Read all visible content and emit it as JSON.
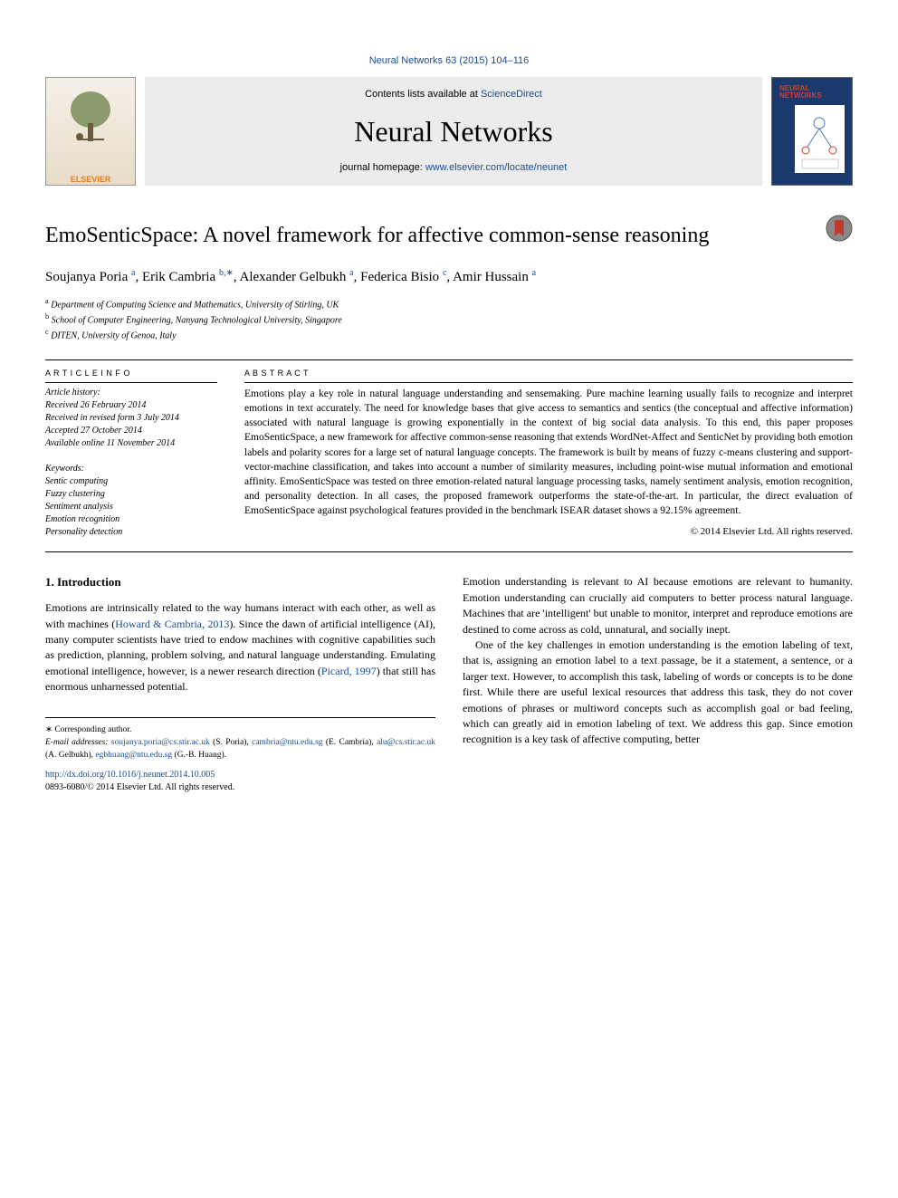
{
  "header": {
    "journal_ref": "Neural Networks 63 (2015) 104–116",
    "contents_prefix": "Contents lists available at ",
    "contents_link": "ScienceDirect",
    "journal_title": "Neural Networks",
    "homepage_prefix": "journal homepage: ",
    "homepage_link": "www.elsevier.com/locate/neunet",
    "publisher_logo": "ELSEVIER",
    "cover_text": "NEURAL NETWORKS"
  },
  "title": "EmoSenticSpace: A novel framework for affective common-sense reasoning",
  "authors": [
    {
      "name": "Soujanya Poria",
      "aff": "a"
    },
    {
      "name": "Erik Cambria",
      "aff": "b,∗"
    },
    {
      "name": "Alexander Gelbukh",
      "aff": "a"
    },
    {
      "name": "Federica Bisio",
      "aff": "c"
    },
    {
      "name": "Amir Hussain",
      "aff": "a"
    }
  ],
  "affiliations": {
    "a": "Department of Computing Science and Mathematics, University of Stirling, UK",
    "b": "School of Computer Engineering, Nanyang Technological University, Singapore",
    "c": "DITEN, University of Genoa, Italy"
  },
  "history": {
    "label": "A R T I C L E   I N F O",
    "history_label": "Article history:",
    "received": "Received 26 February 2014",
    "revised": "Received in revised form 3 July 2014",
    "accepted": "Accepted 27 October 2014",
    "online": "Available online 11 November 2014"
  },
  "keywords": {
    "label": "Keywords:",
    "items": [
      "Sentic computing",
      "Fuzzy clustering",
      "Sentiment analysis",
      "Emotion recognition",
      "Personality detection"
    ]
  },
  "abstract": {
    "label": "A B S T R A C T",
    "text": "Emotions play a key role in natural language understanding and sensemaking. Pure machine learning usually fails to recognize and interpret emotions in text accurately. The need for knowledge bases that give access to semantics and sentics (the conceptual and affective information) associated with natural language is growing exponentially in the context of big social data analysis. To this end, this paper proposes EmoSenticSpace, a new framework for affective common-sense reasoning that extends WordNet-Affect and SenticNet by providing both emotion labels and polarity scores for a large set of natural language concepts. The framework is built by means of fuzzy c-means clustering and support-vector-machine classification, and takes into account a number of similarity measures, including point-wise mutual information and emotional affinity. EmoSenticSpace was tested on three emotion-related natural language processing tasks, namely sentiment analysis, emotion recognition, and personality detection. In all cases, the proposed framework outperforms the state-of-the-art. In particular, the direct evaluation of EmoSenticSpace against psychological features provided in the benchmark ISEAR dataset shows a 92.15% agreement.",
    "copyright": "© 2014 Elsevier Ltd. All rights reserved."
  },
  "body": {
    "section_heading": "1. Introduction",
    "left_para1": "Emotions are intrinsically related to the way humans interact with each other, as well as with machines (",
    "cite_howard": "Howard & Cambria, 2013",
    "left_para1b": "). Since the dawn of artificial intelligence (AI), many computer scientists have tried to endow machines with cognitive capabilities such as prediction, planning, problem solving, and natural language understanding. Emulating emotional intelligence, however, is a newer research direction (",
    "cite_picard": "Picard, 1997",
    "left_para1c": ") that still has enormous unharnessed potential.",
    "right_para1": "Emotion understanding is relevant to AI because emotions are relevant to humanity. Emotion understanding can crucially aid computers to better process natural language. Machines that are 'intelligent' but unable to monitor, interpret and reproduce emotions are destined to come across as cold, unnatural, and socially inept.",
    "right_para2": "One of the key challenges in emotion understanding is the emotion labeling of text, that is, assigning an emotion label to a text passage, be it a statement, a sentence, or a larger text. However, to accomplish this task, labeling of words or concepts is to be done first. While there are useful lexical resources that address this task, they do not cover emotions of phrases or multiword concepts such as accomplish goal or bad feeling, which can greatly aid in emotion labeling of text. We address this gap. Since emotion recognition is a key task of affective computing, better"
  },
  "footnotes": {
    "corr": "∗ Corresponding author.",
    "emails_label": "E-mail addresses: ",
    "email1": "soujanya.poria@cs.stir.ac.uk",
    "name1": " (S. Poria), ",
    "email2": "cambria@ntu.edu.sg",
    "name2": " (E. Cambria), ",
    "email3": "alu@cs.stir.ac.uk",
    "name3": " (A. Gelbukh), ",
    "email4": "egbhuang@ntu.edu.sg",
    "name4": " (G.-B. Huang).",
    "doi": "http://dx.doi.org/10.1016/j.neunet.2014.10.005",
    "bottom_copyright": "0893-6080/© 2014 Elsevier Ltd. All rights reserved."
  }
}
